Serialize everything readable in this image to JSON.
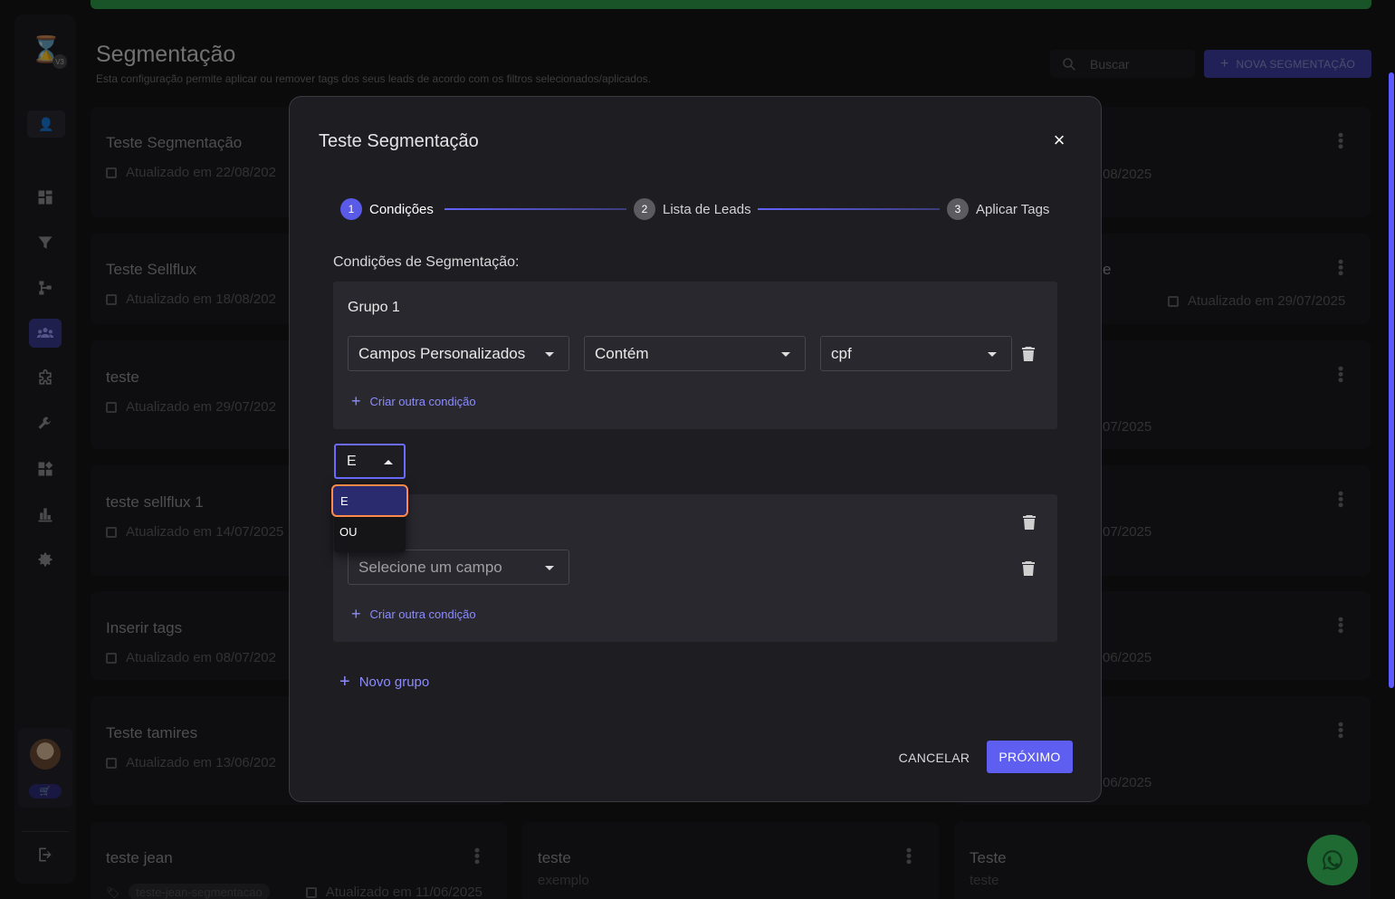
{
  "header": {
    "title": "Segmentação",
    "subtitle": "Esta configuração permite aplicar ou remover tags dos seus leads de acordo com os filtros selecionados/aplicados.",
    "search_placeholder": "Buscar",
    "new_button": "NOVA SEGMENTAÇÃO"
  },
  "sidebar": {
    "logo_badge": "V3",
    "items": [
      "dashboard-icon",
      "funnel-icon",
      "flow-icon",
      "segmentation-icon",
      "integrations-icon",
      "tools-icon",
      "apps-icon",
      "reports-icon",
      "settings-icon"
    ]
  },
  "cards": [
    {
      "title": "Teste Segmentação",
      "date": "Atualizado em 22/08/202"
    },
    {
      "title": "Teste Sellflux",
      "date": "Atualizado em 18/08/202"
    },
    {
      "title": "teste",
      "date": "Atualizado em 29/07/202"
    },
    {
      "title": "teste sellflux 1",
      "date": "Atualizado em 14/07/2025"
    },
    {
      "title": "Inserir tags",
      "date": "Atualizado em 08/07/202"
    },
    {
      "title": "Teste tamires",
      "date": "Atualizado em 13/06/202"
    }
  ],
  "right_cards": [
    "08/2025",
    "Atualizado em 29/07/2025",
    "07/2025",
    "07/2025",
    "06/2025",
    "06/2025"
  ],
  "right_card_fragment": "e",
  "bottom_cards": [
    {
      "title": "teste jean",
      "tag": "teste-jean-segmentacao",
      "date": "Atualizado em 11/06/2025"
    },
    {
      "title": "teste",
      "sub": "exemplo"
    },
    {
      "title": "Teste",
      "sub": "teste"
    }
  ],
  "modal": {
    "title": "Teste Segmentação",
    "close": "×",
    "steps": [
      {
        "num": "1",
        "label": "Condições"
      },
      {
        "num": "2",
        "label": "Lista de Leads"
      },
      {
        "num": "3",
        "label": "Aplicar Tags"
      }
    ],
    "section_title": "Condições de Segmentação:",
    "group1": {
      "title": "Grupo 1",
      "field": "Campos Personalizados",
      "operator": "Contém",
      "value": "cpf",
      "add_condition": "Criar outra condição"
    },
    "logic_operator": "E",
    "logic_options": [
      "E",
      "OU"
    ],
    "group2": {
      "field_placeholder": "Selecione um campo",
      "add_condition": "Criar outra condição"
    },
    "new_group": "Novo grupo",
    "cancel": "CANCELAR",
    "next": "PRÓXIMO"
  },
  "colors": {
    "accent": "#5e5ef0",
    "modal_bg": "#1d1d22",
    "group_bg": "#28282e",
    "highlight": "#ff8a4a"
  }
}
